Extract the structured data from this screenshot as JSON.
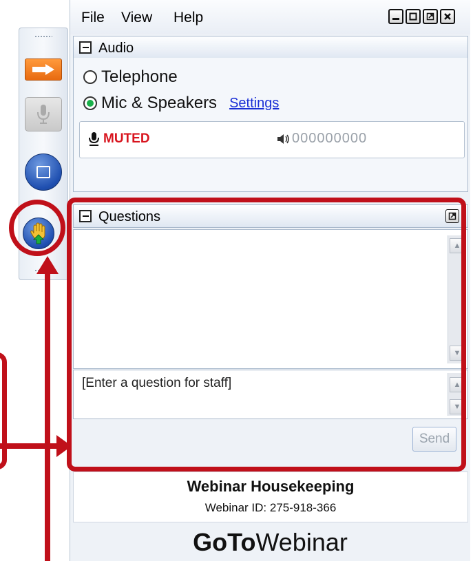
{
  "menubar": {
    "file": "File",
    "view": "View",
    "help": "Help"
  },
  "window_buttons": [
    "minimize-icon",
    "restore-icon",
    "popout-icon",
    "close-icon"
  ],
  "audio": {
    "title": "Audio",
    "telephone": "Telephone",
    "mic_speakers": "Mic & Speakers",
    "settings": "Settings",
    "selected": "mic_speakers",
    "muted_label": "MUTED",
    "level": "000000000"
  },
  "questions": {
    "title": "Questions",
    "input_placeholder": "[Enter a question for staff]",
    "send": "Send"
  },
  "info": {
    "title": "Webinar Housekeeping",
    "webinar_id": "Webinar ID: 275-918-366"
  },
  "brand": {
    "bold": "GoTo",
    "regular": "Webinar"
  },
  "colors": {
    "annotation": "#c0101a",
    "muted": "#d8141e",
    "link": "#1a2fd6",
    "accent": "#1f4fb0"
  }
}
